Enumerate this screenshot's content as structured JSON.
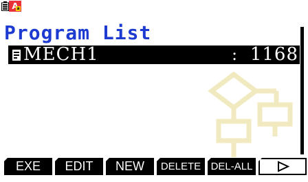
{
  "status_bar": {
    "battery_icon": "battery-icon",
    "mode_icon": "alpha-mode-icon",
    "mode_letter": "A",
    "mode_sub": "a"
  },
  "page_title": "Program List",
  "programs": [
    {
      "name": "MECH1",
      "separator": ":",
      "size": "1168",
      "selected": true
    }
  ],
  "function_keys": [
    {
      "label": "EXE"
    },
    {
      "label": "EDIT"
    },
    {
      "label": "NEW"
    },
    {
      "label": "DELETE"
    },
    {
      "label": "DEL-ALL"
    },
    {
      "label": "▷",
      "icon": "next-page-icon"
    }
  ],
  "colors": {
    "title": "#1d3ad1",
    "alpha_badge": "#e8333b",
    "alpha_badge_small": "#f4d000",
    "watermark": "#efe6b6"
  }
}
